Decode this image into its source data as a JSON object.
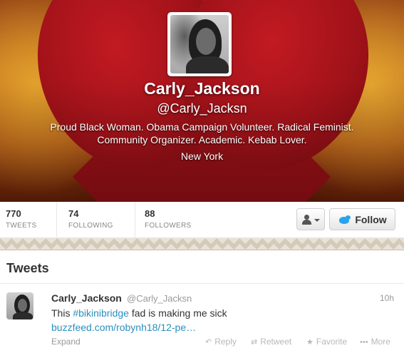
{
  "profile": {
    "name": "Carly_Jackson",
    "handle": "@Carly_Jacksn",
    "bio": "Proud Black Woman. Obama Campaign Volunteer. Radical Feminist. Community Organizer. Academic. Kebab Lover.",
    "location": "New York"
  },
  "stats": [
    {
      "value": "770",
      "label": "TWEETS"
    },
    {
      "value": "74",
      "label": "FOLLOWING"
    },
    {
      "value": "88",
      "label": "FOLLOWERS"
    }
  ],
  "buttons": {
    "user_actions_icon": "user-icon",
    "follow_label": "Follow"
  },
  "tweets_section": {
    "title": "Tweets"
  },
  "tweet": {
    "name": "Carly_Jackson",
    "handle": "@Carly_Jacksn",
    "time": "10h",
    "text_before": "This ",
    "hashtag": "#bikinibridge",
    "text_after": " fad is making me sick",
    "link": "buzzfeed.com/robynh18/12-pe…",
    "expand_label": "Expand",
    "actions": {
      "reply": "Reply",
      "retweet": "Retweet",
      "favorite": "Favorite",
      "more": "More"
    }
  },
  "colors": {
    "link": "#2a8fbd",
    "twitter_blue": "#2aa3ef",
    "header_red": "#b2141d"
  }
}
